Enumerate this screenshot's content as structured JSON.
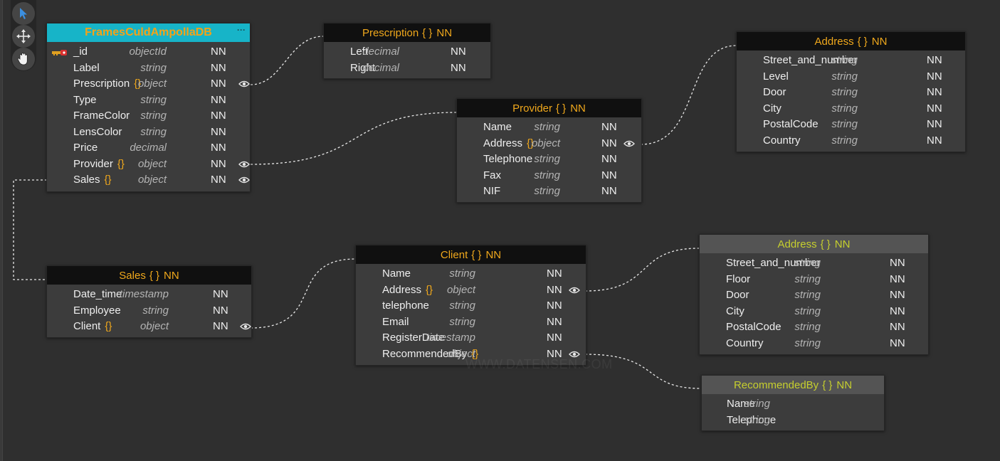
{
  "colors": {
    "canvas": "#2f2f2f",
    "table_body": "#3c3c3c",
    "header_black": "#101010",
    "header_sub": "#545454",
    "header_root": "#17b4c8",
    "title_orange": "#f0a81c",
    "title_yellowgreen": "#c6cf2e",
    "type_text": "#b4b4b4"
  },
  "toolbar": {
    "tools": [
      {
        "name": "pointer-icon"
      },
      {
        "name": "move-icon"
      },
      {
        "name": "hand-icon"
      }
    ]
  },
  "watermark": "WWW.DATENSEN.COM",
  "tables": {
    "frames": {
      "title": "FramesCuldAmpollaDB",
      "menu": "···",
      "fields": [
        {
          "name": "_id",
          "type": "objectId",
          "nn": "NN",
          "key": true
        },
        {
          "name": "Label",
          "type": "string",
          "nn": "NN"
        },
        {
          "name": "Prescription",
          "brace": "{}",
          "type": "object",
          "nn": "NN",
          "eye": true
        },
        {
          "name": "Type",
          "type": "string",
          "nn": "NN"
        },
        {
          "name": "FrameColor",
          "type": "string",
          "nn": "NN"
        },
        {
          "name": "LensColor",
          "type": "string",
          "nn": "NN"
        },
        {
          "name": "Price",
          "type": "decimal",
          "nn": "NN"
        },
        {
          "name": "Provider",
          "brace": "{}",
          "type": "object",
          "nn": "NN",
          "eye": true
        },
        {
          "name": "Sales",
          "brace": "{}",
          "type": "object",
          "nn": "NN",
          "eye": true
        }
      ]
    },
    "prescription": {
      "title": "Prescription",
      "brace": "{ }",
      "nn": "NN",
      "fields": [
        {
          "name": "Left",
          "type": "decimal",
          "nn": "NN"
        },
        {
          "name": "Right",
          "type": "decimal",
          "nn": "NN"
        }
      ]
    },
    "provider": {
      "title": "Provider",
      "brace": "{ }",
      "nn": "NN",
      "fields": [
        {
          "name": "Name",
          "type": "string",
          "nn": "NN"
        },
        {
          "name": "Address",
          "brace": "{}",
          "type": "object",
          "nn": "NN",
          "eye": true
        },
        {
          "name": "Telephone",
          "type": "string",
          "nn": "NN"
        },
        {
          "name": "Fax",
          "type": "string",
          "nn": "NN"
        },
        {
          "name": "NIF",
          "type": "string",
          "nn": "NN"
        }
      ]
    },
    "address_provider": {
      "title": "Address",
      "brace": "{ }",
      "nn": "NN",
      "fields": [
        {
          "name": "Street_and_number",
          "type": "string",
          "nn": "NN"
        },
        {
          "name": "Level",
          "type": "string",
          "nn": "NN"
        },
        {
          "name": "Door",
          "type": "string",
          "nn": "NN"
        },
        {
          "name": "City",
          "type": "string",
          "nn": "NN"
        },
        {
          "name": "PostalCode",
          "type": "string",
          "nn": "NN"
        },
        {
          "name": "Country",
          "type": "string",
          "nn": "NN"
        }
      ]
    },
    "sales": {
      "title": "Sales",
      "brace": "{ }",
      "nn": "NN",
      "fields": [
        {
          "name": "Date_time",
          "type": "timestamp",
          "nn": "NN"
        },
        {
          "name": "Employee",
          "type": "string",
          "nn": "NN"
        },
        {
          "name": "Client",
          "brace": "{}",
          "type": "object",
          "nn": "NN",
          "eye": true
        }
      ]
    },
    "client": {
      "title": "Client",
      "brace": "{ }",
      "nn": "NN",
      "fields": [
        {
          "name": "Name",
          "type": "string",
          "nn": "NN"
        },
        {
          "name": "Address",
          "brace": "{}",
          "type": "object",
          "nn": "NN",
          "eye": true
        },
        {
          "name": "telephone",
          "type": "string",
          "nn": "NN"
        },
        {
          "name": "Email",
          "type": "string",
          "nn": "NN"
        },
        {
          "name": "RegisterDate",
          "type": "timestamp",
          "nn": "NN"
        },
        {
          "name": "RecommendedBy",
          "brace": "{}",
          "type": "object",
          "nn": "NN",
          "eye": true
        }
      ]
    },
    "address_client": {
      "title": "Address",
      "brace": "{ }",
      "nn": "NN",
      "fields": [
        {
          "name": "Street_and_number",
          "type": "string",
          "nn": "NN"
        },
        {
          "name": "Floor",
          "type": "string",
          "nn": "NN"
        },
        {
          "name": "Door",
          "type": "string",
          "nn": "NN"
        },
        {
          "name": "City",
          "type": "string",
          "nn": "NN"
        },
        {
          "name": "PostalCode",
          "type": "string",
          "nn": "NN"
        },
        {
          "name": "Country",
          "type": "string",
          "nn": "NN"
        }
      ]
    },
    "recommended_by": {
      "title": "RecommendedBy",
      "brace": "{ }",
      "nn": "NN",
      "fields": [
        {
          "name": "Name",
          "type": "string"
        },
        {
          "name": "Telephone",
          "type": "string"
        }
      ]
    }
  }
}
